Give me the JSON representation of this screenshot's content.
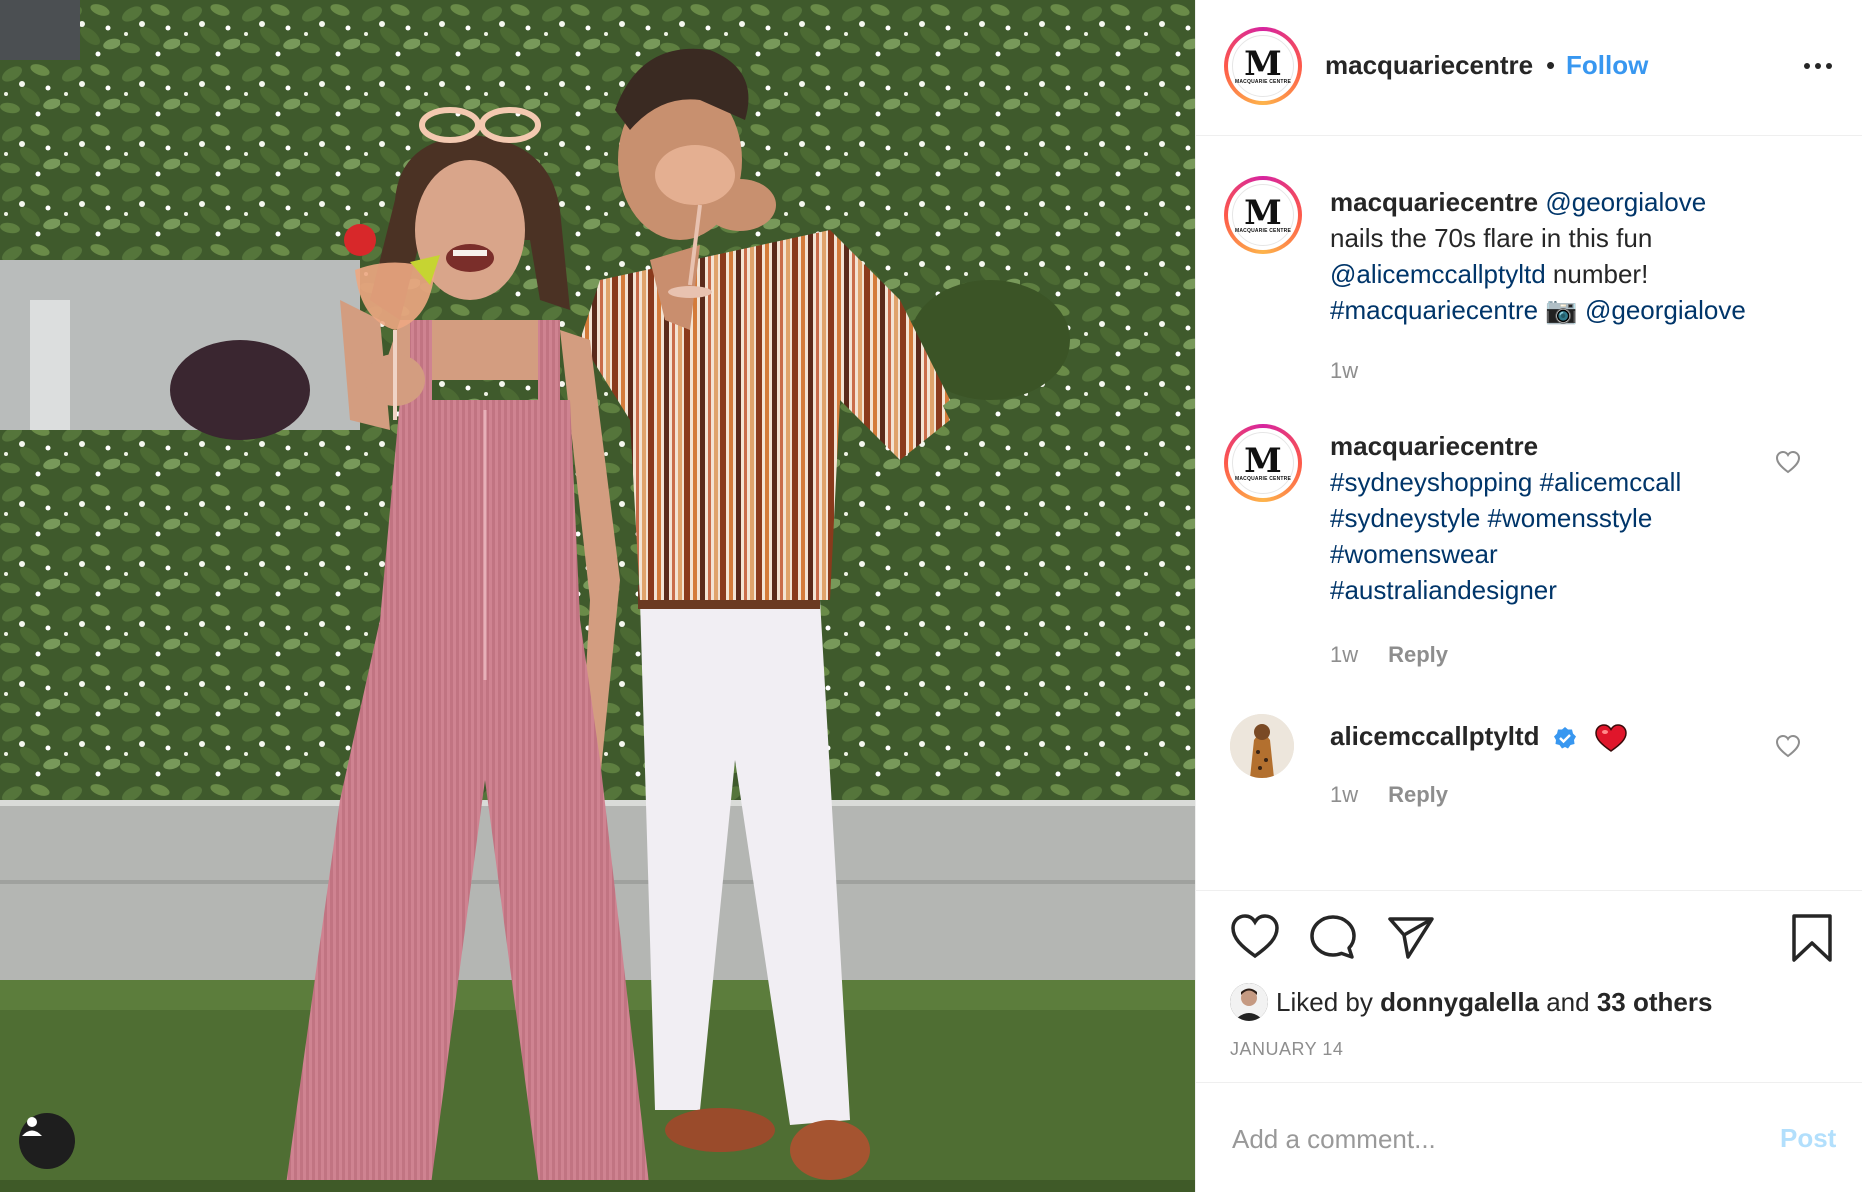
{
  "post": {
    "image_alt": "Woman in pink corduroy overalls and man in striped shirt holding cocktails in front of a hedge",
    "tag_icon": "user-tag-icon"
  },
  "header": {
    "username": "macquariecentre",
    "separator": "•",
    "follow_label": "Follow",
    "more_icon": "more-options-icon",
    "avatar_logo": "M",
    "avatar_sub": "MACQUARIE CENTRE"
  },
  "caption": {
    "username": "macquariecentre",
    "mention1": "@georgialove",
    "text1": " nails the 70s flare in this fun ",
    "mention2": "@alicemccallptyltd",
    "text2": " number! ",
    "hashtag": "#macquariecentre",
    "camera_emoji": "📷",
    "mention3": "@georgialove",
    "time": "1w"
  },
  "comments": [
    {
      "username": "macquariecentre",
      "hashtags": [
        "#sydneyshopping",
        "#alicemccall",
        "#sydneystyle",
        "#womensstyle",
        "#womenswear",
        "#australiandesigner"
      ],
      "time": "1w",
      "reply_label": "Reply"
    },
    {
      "username": "alicemccallptyltd",
      "verified": true,
      "time": "1w",
      "reply_label": "Reply"
    }
  ],
  "actions": {
    "like_icon": "heart-icon",
    "comment_icon": "comment-icon",
    "share_icon": "share-icon",
    "save_icon": "bookmark-icon",
    "liked_prefix": "Liked by ",
    "liked_user": "donnygalella",
    "liked_mid": " and ",
    "liked_others": "33 others",
    "date": "JANUARY 14"
  },
  "add_comment": {
    "placeholder": "Add a comment...",
    "post_label": "Post"
  },
  "colors": {
    "link": "#003569",
    "follow": "#3897f0",
    "muted": "#8e8e8e",
    "post_disabled": "#b2dffc",
    "verified": "#3897f0"
  }
}
